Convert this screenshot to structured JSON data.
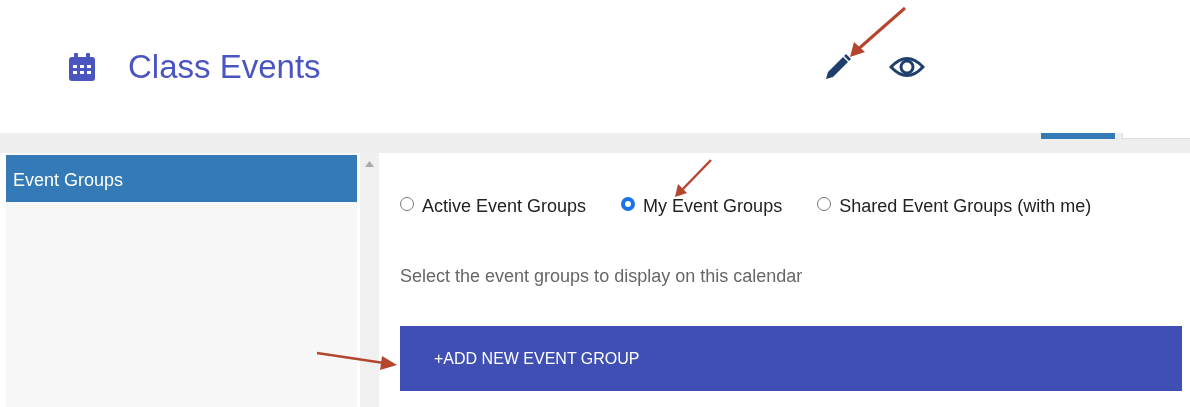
{
  "header": {
    "title": "Class Events"
  },
  "sidebar": {
    "items": [
      {
        "label": "Event Groups",
        "selected": true
      }
    ]
  },
  "filter": {
    "options": [
      {
        "label": "Active Event Groups",
        "selected": false
      },
      {
        "label": "My Event Groups",
        "selected": true
      },
      {
        "label": "Shared Event Groups (with me)",
        "selected": false
      }
    ]
  },
  "help_text": "Select the event groups to display on this calendar",
  "add_button": {
    "icon": "+",
    "label": "ADD NEW EVENT GROUP"
  }
}
